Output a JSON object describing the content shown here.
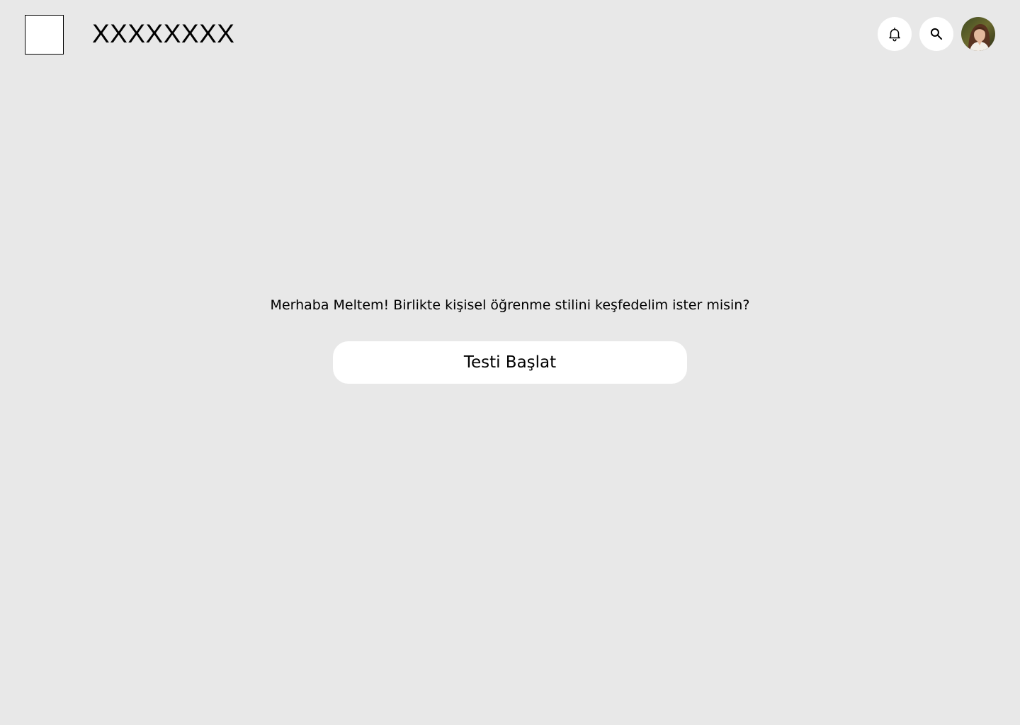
{
  "header": {
    "brand_text": "XXXXXXXX",
    "icons": {
      "notifications": "bell-icon",
      "search": "search-icon",
      "profile": "avatar"
    }
  },
  "main": {
    "greeting": "Merhaba Meltem! Birlikte kişisel öğrenme stilini keşfedelim ister misin?",
    "start_button_label": "Testi Başlat"
  },
  "colors": {
    "background": "#e8e8e8",
    "surface": "#ffffff",
    "text": "#000000"
  }
}
